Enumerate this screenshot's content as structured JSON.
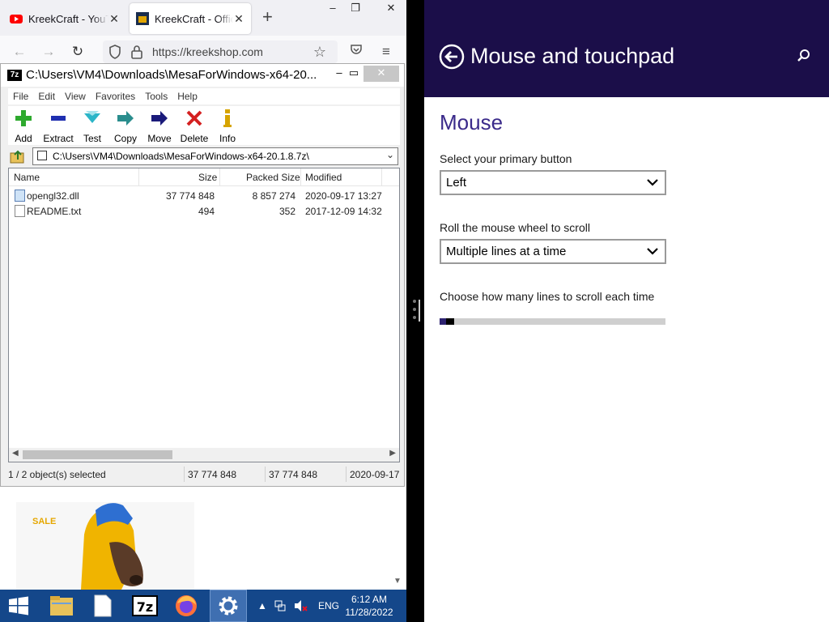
{
  "browser": {
    "tabs": [
      {
        "title": "KreekCraft - YouTube",
        "state": "inactive"
      },
      {
        "title": "KreekCraft - Official",
        "state": "active"
      }
    ],
    "url": "https://kreekshop.com",
    "new_tab": "+",
    "window_controls": {
      "minimize": "–",
      "restore": "❐",
      "close": "✕"
    }
  },
  "sevenzip": {
    "title": "C:\\Users\\VM4\\Downloads\\MesaForWindows-x64-20...",
    "app_icon": "7z",
    "menu": [
      "File",
      "Edit",
      "View",
      "Favorites",
      "Tools",
      "Help"
    ],
    "toolbar": [
      {
        "label": "Add",
        "icon": "add-icon",
        "color": "#2eaa2e"
      },
      {
        "label": "Extract",
        "icon": "extract-icon",
        "color": "#1f2fb0"
      },
      {
        "label": "Test",
        "icon": "test-icon",
        "color": "#2cb5c8"
      },
      {
        "label": "Copy",
        "icon": "copy-icon",
        "color": "#2a8d8d"
      },
      {
        "label": "Move",
        "icon": "move-icon",
        "color": "#1a1a7a"
      },
      {
        "label": "Delete",
        "icon": "delete-icon",
        "color": "#d42020"
      },
      {
        "label": "Info",
        "icon": "info-icon",
        "color": "#d6a400"
      }
    ],
    "path": "C:\\Users\\VM4\\Downloads\\MesaForWindows-x64-20.1.8.7z\\",
    "columns": [
      "Name",
      "Size",
      "Packed Size",
      "Modified"
    ],
    "files": [
      {
        "name": "opengl32.dll",
        "size": "37 774 848",
        "packed": "8 857 274",
        "modified": "2020-09-17 13:27",
        "type": "dll"
      },
      {
        "name": "README.txt",
        "size": "494",
        "packed": "352",
        "modified": "2017-12-09 14:32",
        "type": "txt"
      }
    ],
    "status": {
      "selection": "1 / 2 object(s) selected",
      "size": "37 774 848",
      "packed": "37 774 848",
      "modified": "2020-09-17"
    }
  },
  "ad": {
    "sale_text": "SALE"
  },
  "settings": {
    "title": "Mouse and touchpad",
    "section": "Mouse",
    "primary_button": {
      "label": "Select your primary button",
      "value": "Left"
    },
    "wheel_scroll": {
      "label": "Roll the mouse wheel to scroll",
      "value": "Multiple lines at a time"
    },
    "lines_scroll": {
      "label": "Choose how many lines to scroll each time",
      "value_fraction": 0.03
    },
    "accent": "#1b0e49"
  },
  "taskbar": {
    "tray_lang": "ENG",
    "time": "6:12 AM",
    "date": "11/28/2022",
    "tray_arrow": "▲",
    "pinned": [
      {
        "name": "start-button",
        "icon": "windows-logo-icon"
      },
      {
        "name": "file-explorer",
        "icon": "folder-icon"
      },
      {
        "name": "blank-document",
        "icon": "document-icon"
      },
      {
        "name": "7zip-taskbar",
        "icon": "sevenzip-icon",
        "label": "7z"
      },
      {
        "name": "firefox-taskbar",
        "icon": "firefox-icon"
      },
      {
        "name": "settings-taskbar",
        "icon": "gear-icon"
      }
    ]
  }
}
